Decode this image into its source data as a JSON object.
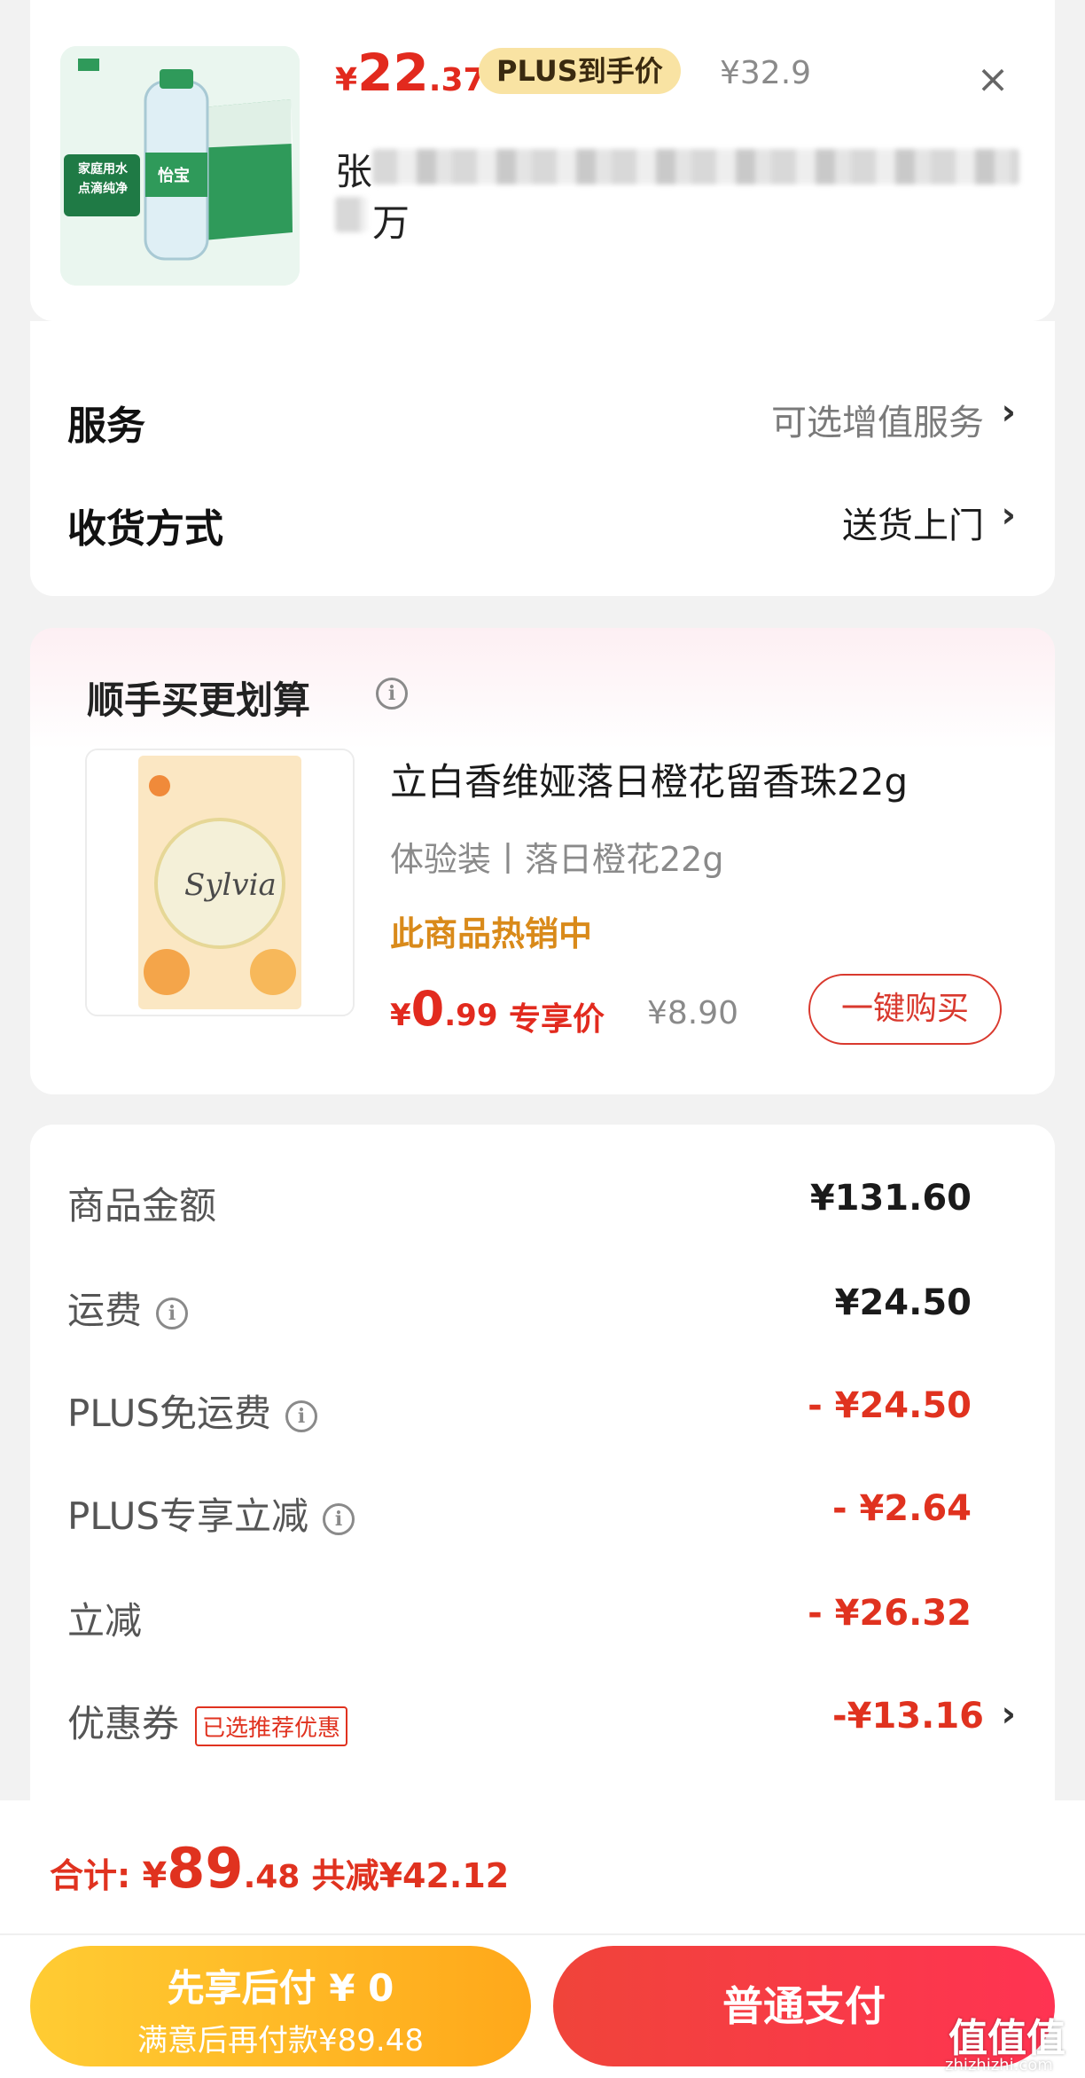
{
  "top_item": {
    "price_currency": "¥",
    "price_int": "22",
    "price_dec": ".37",
    "plus_tag": "PLUS到手价",
    "old_price": "¥32.9",
    "close_icon": "close-icon",
    "name_char_1": "张",
    "name_char_2": "万",
    "thumb_badge": "家庭用水\n点滴纯净",
    "thumb_brand": "怡宝"
  },
  "service": {
    "label": "服务",
    "value": "可选增值服务",
    "chevron": "›"
  },
  "delivery": {
    "label": "收货方式",
    "value": "送货上门",
    "chevron": "›"
  },
  "recommend": {
    "title": "顺手买更划算",
    "info_icon": "info-icon",
    "product_name": "立白香维娅落日橙花留香珠22g",
    "spec": "体验装丨落日橙花22g",
    "hot_text": "此商品热销中",
    "price_currency": "¥",
    "price_int": "0",
    "price_dec": ".99",
    "exclusive_label": "专享价",
    "old_price": "¥8.90",
    "buy_button": "一键购买",
    "thumb_brand": "Sylvia"
  },
  "summary": {
    "rows": [
      {
        "label": "商品金额",
        "value": "¥131.60",
        "red": false,
        "info": false
      },
      {
        "label": "运费",
        "value": "¥24.50",
        "red": false,
        "info": true
      },
      {
        "label": "PLUS免运费",
        "value": "- ¥24.50",
        "red": true,
        "info": true
      },
      {
        "label": "PLUS专享立减",
        "value": "- ¥2.64",
        "red": true,
        "info": true
      },
      {
        "label": "立减",
        "value": "- ¥26.32",
        "red": true,
        "info": false
      }
    ],
    "coupon_label": "优惠券",
    "coupon_tag": "已选推荐优惠",
    "coupon_value": "-¥13.16",
    "coupon_chevron": "›"
  },
  "footer": {
    "total_label": "合计: ",
    "total_currency": "¥",
    "total_int": "89",
    "total_dec": ".48",
    "saved_text": " 共减¥42.12",
    "pay_later_title": "先享后付 ¥ 0",
    "pay_later_sub": "满意后再付款¥89.48",
    "pay_now": "普通支付"
  },
  "watermark": {
    "main": "值值值",
    "sub": "zhizhizhi.com"
  },
  "colors": {
    "accent_red": "#e22a1e",
    "plus_gold": "#f9e3a3",
    "pay_later_yellow": "#ffb420",
    "pay_now_red": "#f0443a"
  }
}
